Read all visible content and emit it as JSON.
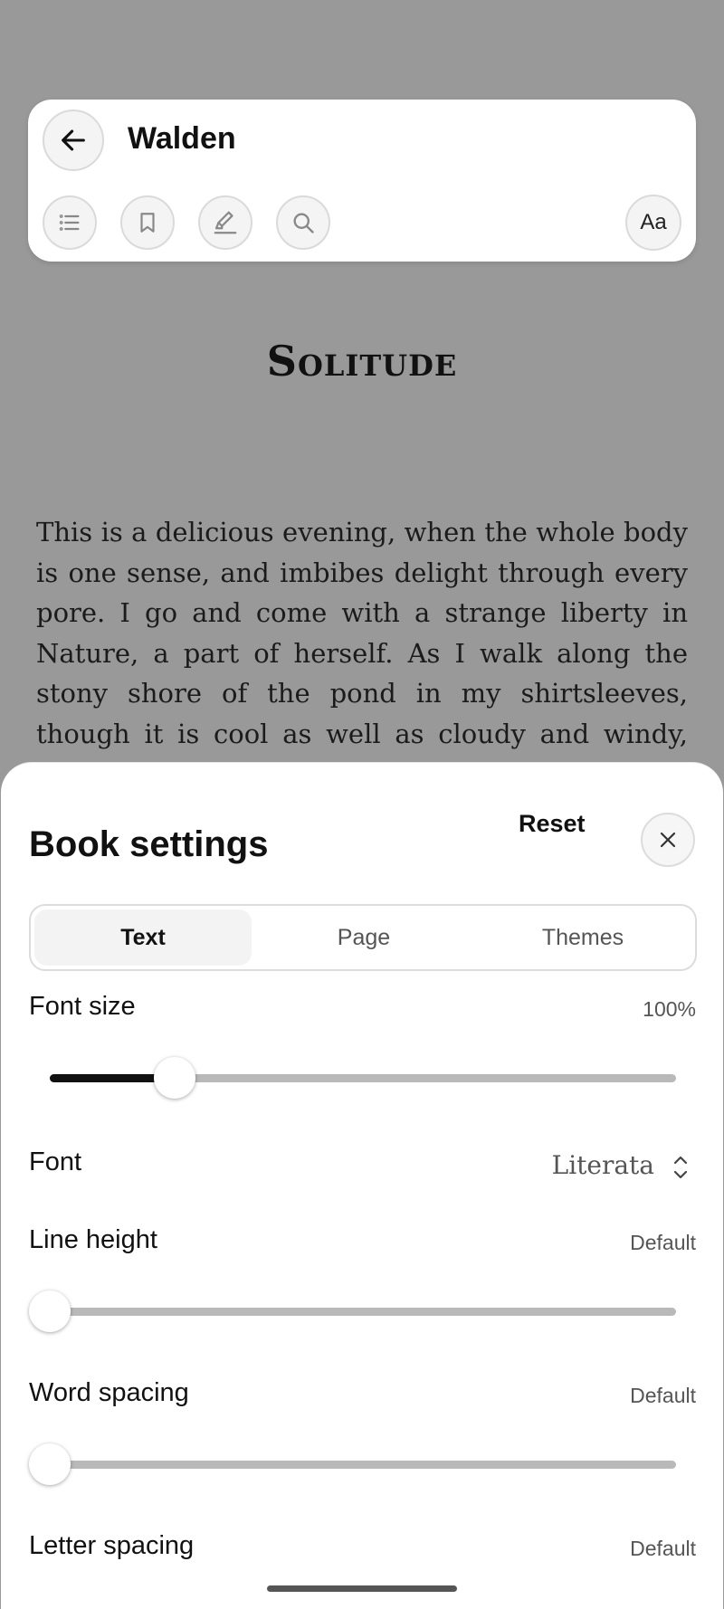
{
  "app": {
    "book_title": "Walden",
    "chapter_title": "Solitude",
    "body_text": "This is a delicious evening, when the whole body is one sense, and imbibes delight through every pore. I go and come with a strange liberty in Nature, a part of herself. As I walk along the stony shore of the pond in my shirtsleeves, though it is cool as well as cloudy and windy, and"
  },
  "toolbar": {
    "icons": [
      "back-arrow-icon",
      "toc-list-icon",
      "bookmark-icon",
      "highlighter-icon",
      "search-icon",
      "text-settings-icon"
    ],
    "aa_label": "Aa"
  },
  "settings": {
    "title": "Book settings",
    "reset_label": "Reset",
    "tabs": [
      {
        "label": "Text",
        "active": true
      },
      {
        "label": "Page",
        "active": false
      },
      {
        "label": "Themes",
        "active": false
      }
    ],
    "font_size": {
      "label": "Font size",
      "value": "100%",
      "level": 0.2
    },
    "font": {
      "label": "Font",
      "value": "Literata"
    },
    "line_height": {
      "label": "Line height",
      "value": "Default",
      "level": 0.0
    },
    "word_spacing": {
      "label": "Word spacing",
      "value": "Default",
      "level": 0.0
    },
    "letter_spacing": {
      "label": "Letter spacing",
      "value": "Default"
    }
  },
  "colors": {
    "accent": "#111111",
    "track": "#b9b9b9",
    "overlay": "#999999"
  }
}
